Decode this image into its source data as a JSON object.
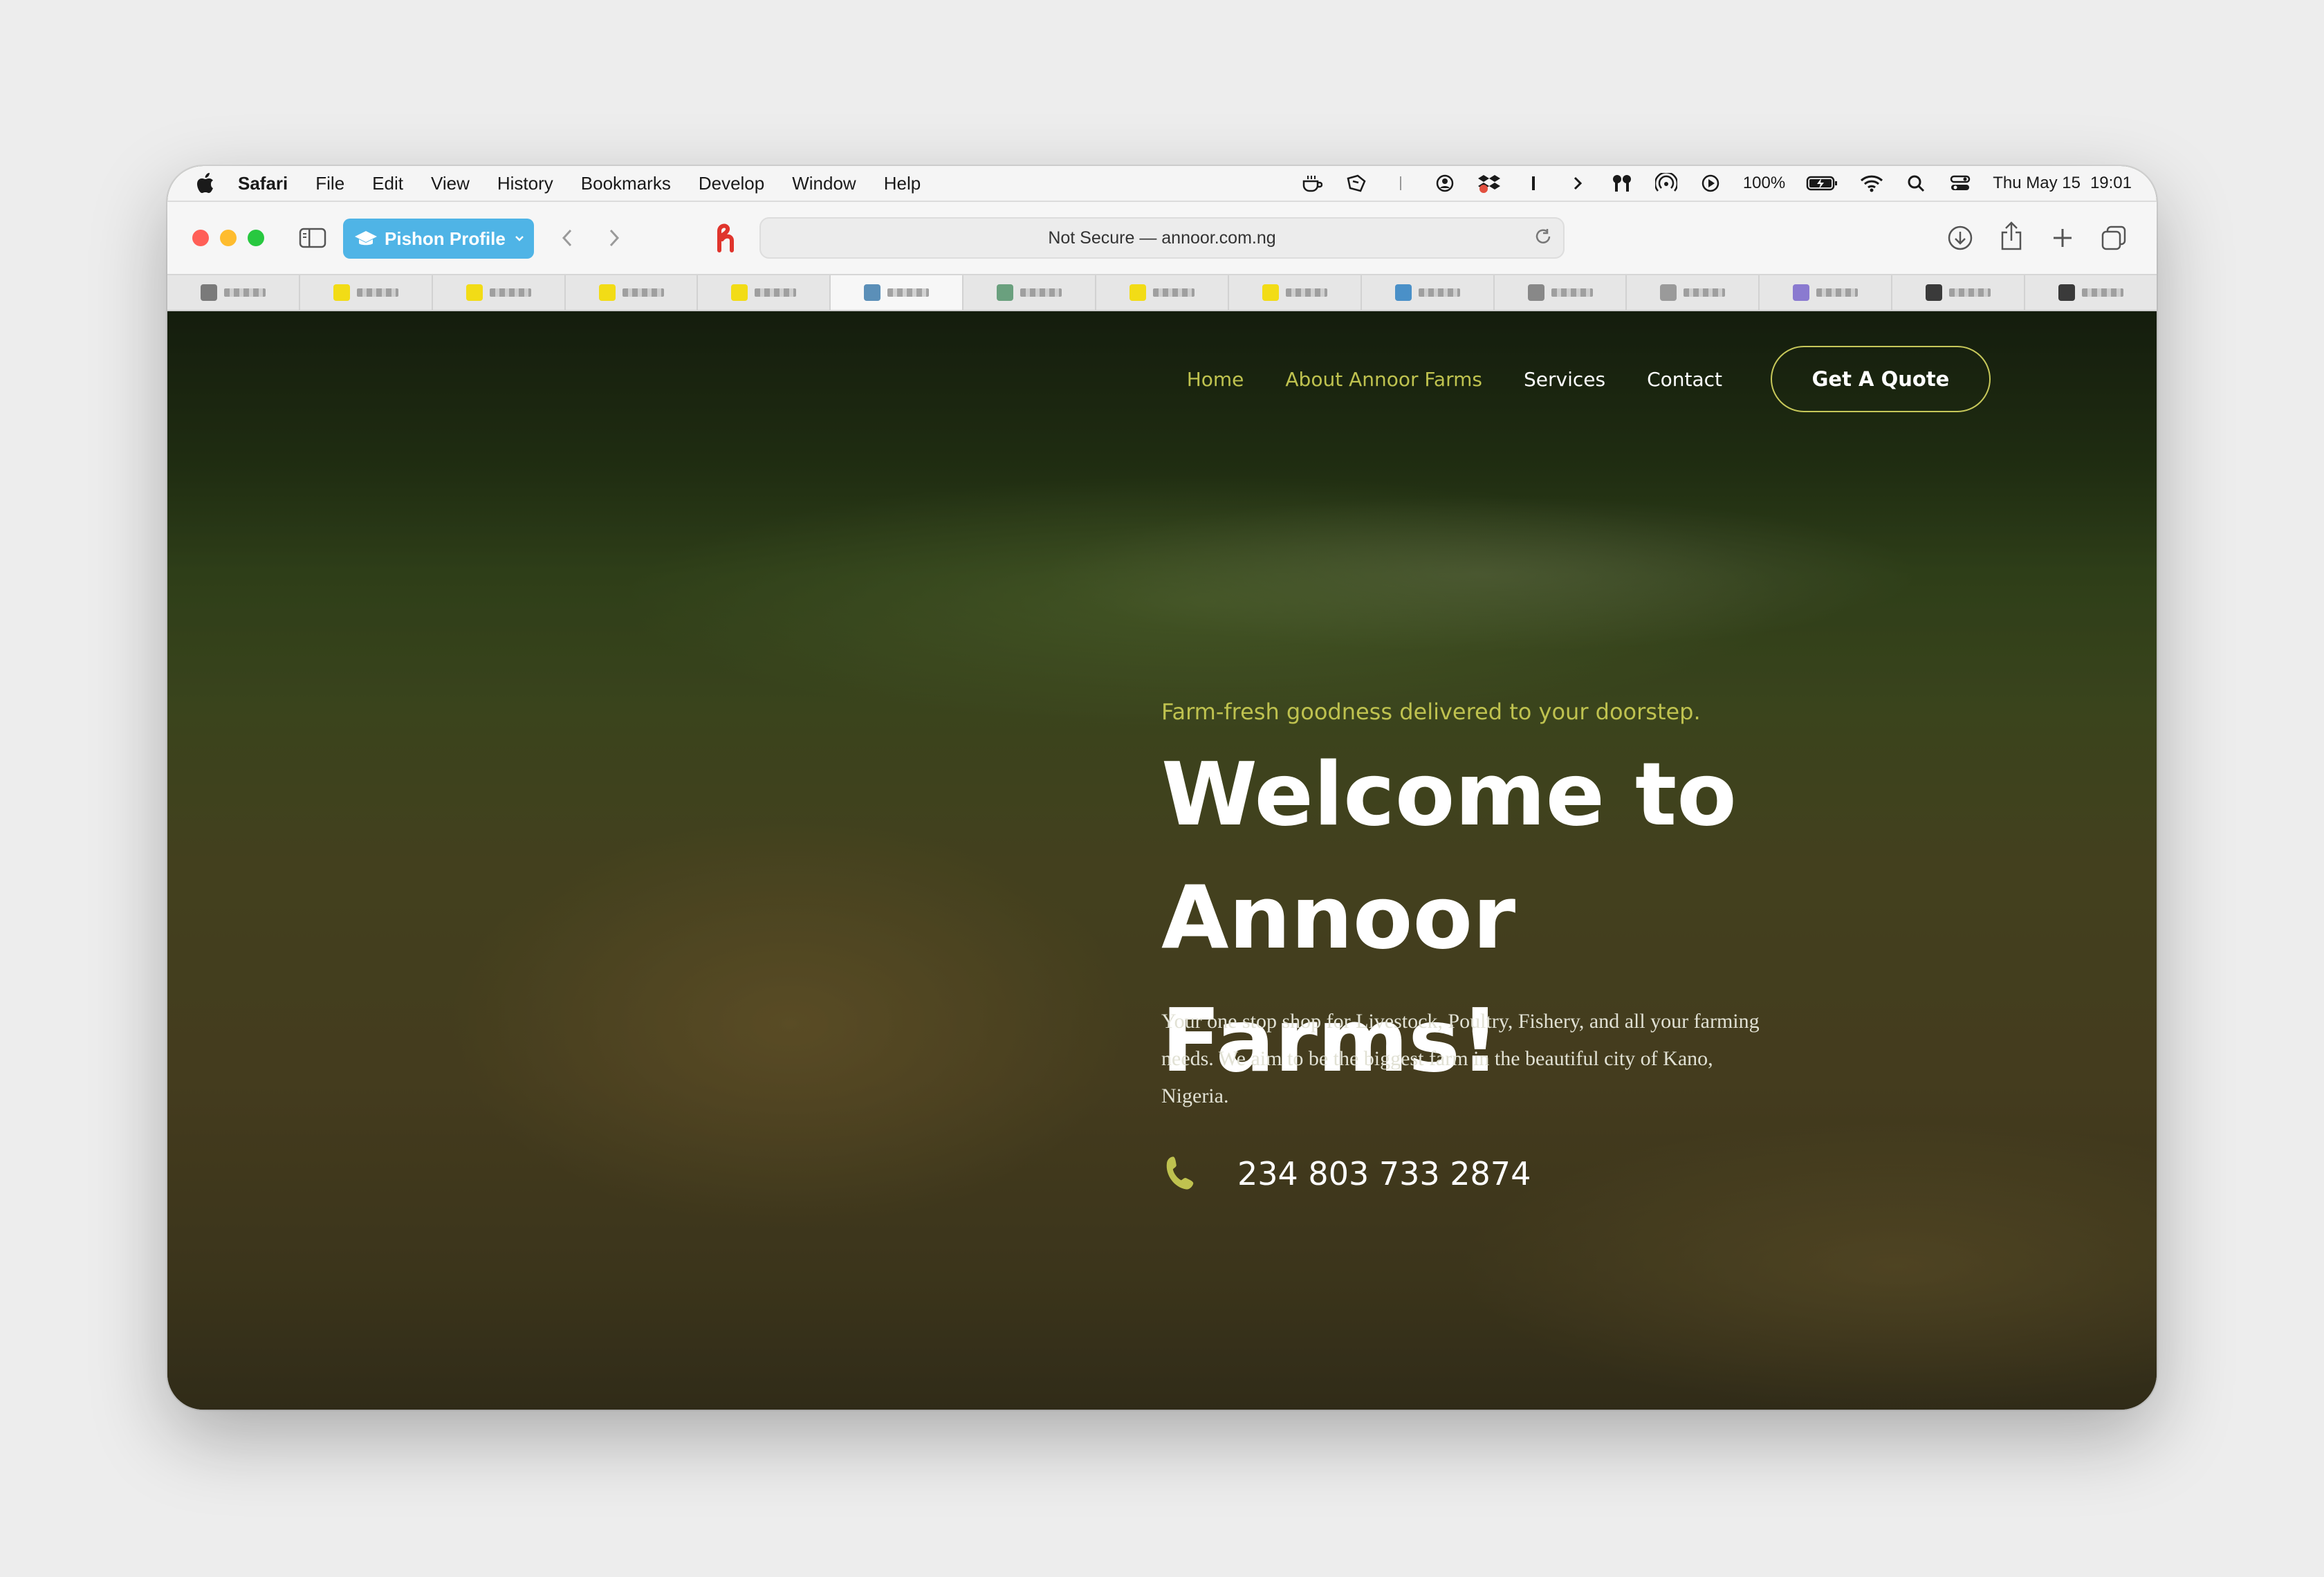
{
  "menubar": {
    "app_name": "Safari",
    "items": [
      "File",
      "Edit",
      "View",
      "History",
      "Bookmarks",
      "Develop",
      "Window",
      "Help"
    ],
    "battery": "100%",
    "date": "Thu May 15",
    "time": "19:01"
  },
  "toolbar": {
    "profile_label": "Pishon Profile",
    "url_text": "Not Secure — annoor.com.ng"
  },
  "site": {
    "nav": [
      "Home",
      "About Annoor Farms",
      "Services",
      "Contact"
    ],
    "quote_button": "Get A Quote",
    "tagline": "Farm-fresh goodness delivered to your doorstep.",
    "title_line1": "Welcome to",
    "title_line2": "Annoor Farms!",
    "description": "Your one stop shop for Livestock, Poultry, Fishery, and all your farming needs. We aim to be the biggest farm in the beautiful city of Kano, Nigeria.",
    "phone": "234 803 733 2874"
  },
  "colors": {
    "accent": "#bfc24f",
    "profile_bg": "#4fb4e6",
    "close": "#ff5f57",
    "minimize": "#febc2e",
    "zoom": "#28c840"
  }
}
